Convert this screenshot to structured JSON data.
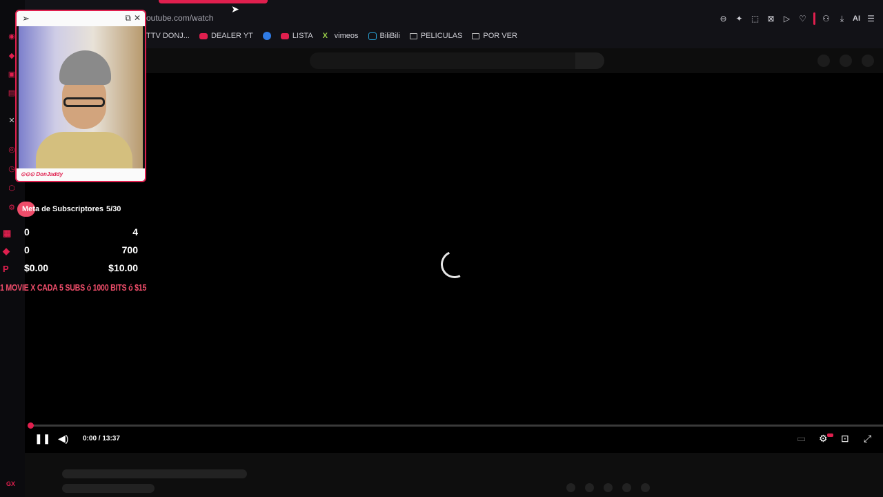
{
  "browser": {
    "url": "outube.com/watch",
    "bookmarks": [
      {
        "label": "TTV DONJ...",
        "icon": "none"
      },
      {
        "label": "DEALER YT",
        "icon": "youtube"
      },
      {
        "label": "",
        "icon": "blue-circle"
      },
      {
        "label": "LISTA",
        "icon": "youtube"
      },
      {
        "label": "vimeos",
        "icon": "x-icon"
      },
      {
        "label": "BiliBili",
        "icon": "bilibili"
      },
      {
        "label": "PELICULAS",
        "icon": "folder"
      },
      {
        "label": "POR VER",
        "icon": "folder"
      }
    ],
    "toolbar_ai_label": "AI",
    "sidebar_brand": "GX",
    "accent_color": "#e01f4e"
  },
  "webcam": {
    "streamer_name": "DonJaddy"
  },
  "goals": {
    "title": "Meta de Subscriptores",
    "count": "5/30",
    "rows": [
      {
        "icon": "gift-icon",
        "left": "0",
        "right": "4"
      },
      {
        "icon": "gem-icon",
        "left": "0",
        "right": "700"
      },
      {
        "icon": "paypal-icon",
        "left": "$0.00",
        "right": "$10.00"
      }
    ],
    "banner": "1 MOVIE X CADA 5 SUBS ó 1000 BITS ó $15"
  },
  "player": {
    "time": "0:00 / 13:37",
    "progress": 0.0
  }
}
